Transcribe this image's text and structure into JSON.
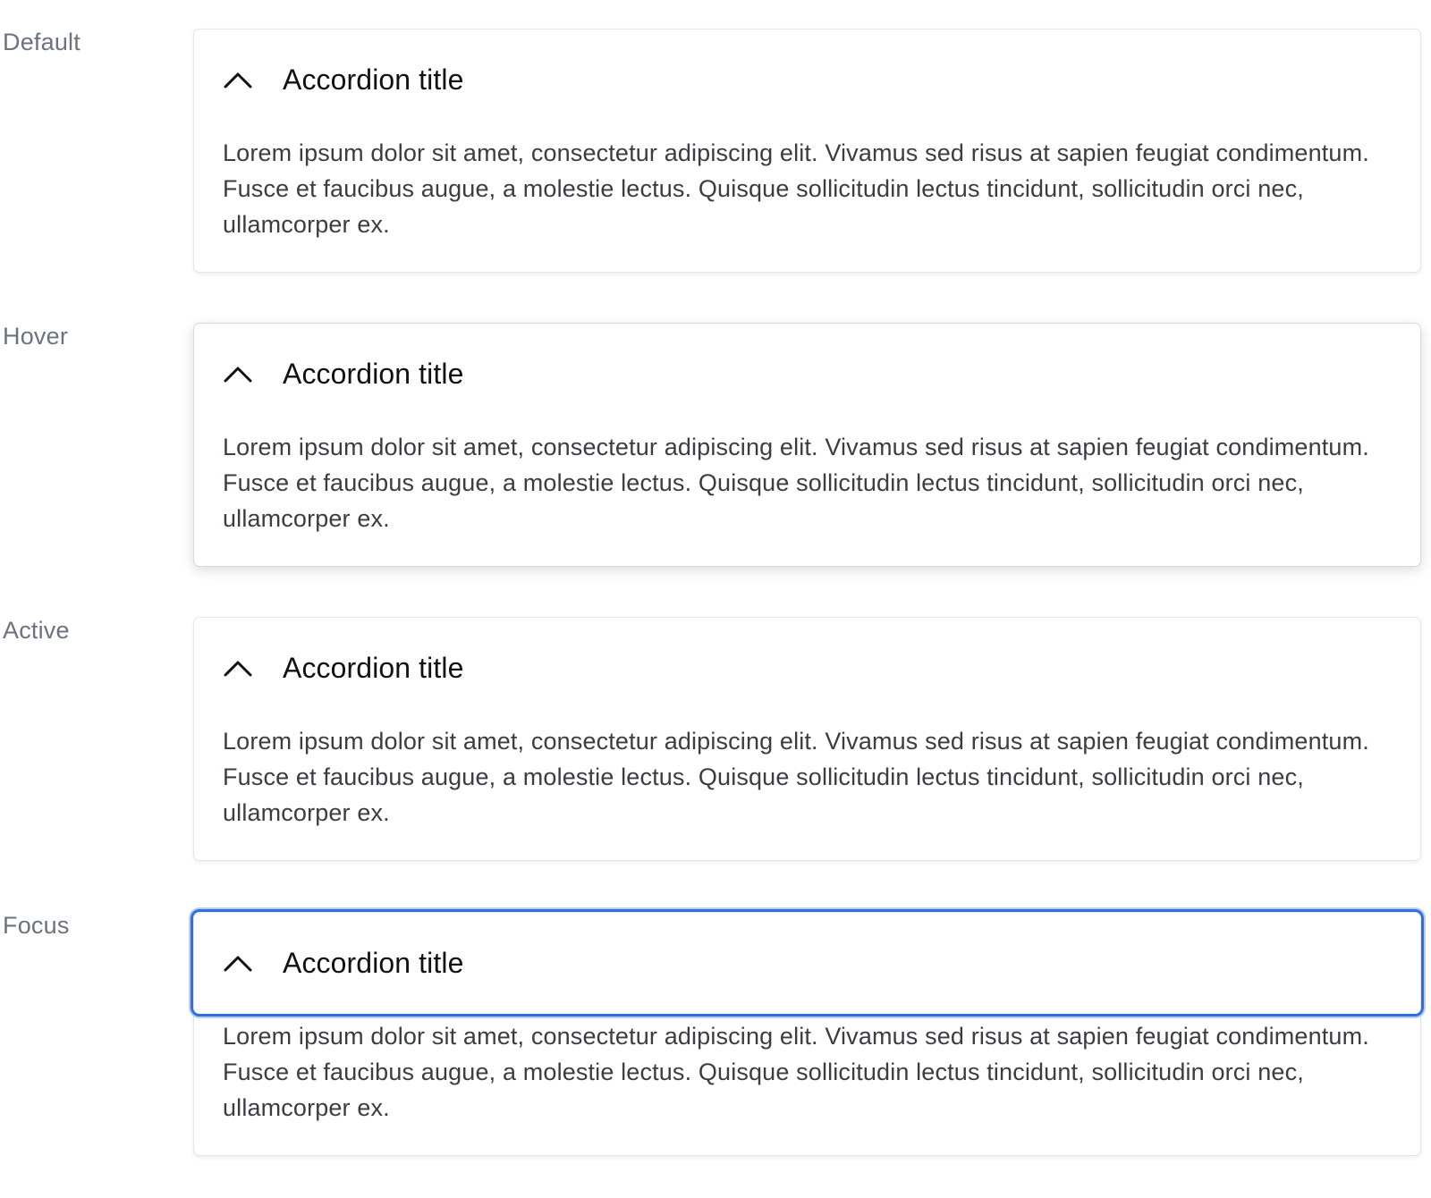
{
  "states": [
    {
      "label": "Default",
      "accordion": {
        "title": "Accordion title",
        "body": "Lorem ipsum dolor sit amet, consectetur adipiscing elit. Vivamus sed risus at sapien feugiat condimentum. Fusce et faucibus augue, a molestie lectus. Quisque sollicitudin lectus tincidunt, sollicitudin orci nec, ullamcorper ex.",
        "icon": "chevron-up-icon"
      }
    },
    {
      "label": "Hover",
      "accordion": {
        "title": "Accordion title",
        "body": "Lorem ipsum dolor sit amet, consectetur adipiscing elit. Vivamus sed risus at sapien feugiat condimentum. Fusce et faucibus augue, a molestie lectus. Quisque sollicitudin lectus tincidunt, sollicitudin orci nec, ullamcorper ex.",
        "icon": "chevron-up-icon"
      }
    },
    {
      "label": "Active",
      "accordion": {
        "title": "Accordion title",
        "body": "Lorem ipsum dolor sit amet, consectetur adipiscing elit. Vivamus sed risus at sapien feugiat condimentum. Fusce et faucibus augue, a molestie lectus. Quisque sollicitudin lectus tincidunt, sollicitudin orci nec, ullamcorper ex.",
        "icon": "chevron-up-icon"
      }
    },
    {
      "label": "Focus",
      "accordion": {
        "title": "Accordion title",
        "body": "Lorem ipsum dolor sit amet, consectetur adipiscing elit. Vivamus sed risus at sapien feugiat condimentum. Fusce et faucibus augue, a molestie lectus. Quisque sollicitudin lectus tincidunt, sollicitudin orci nec, ullamcorper ex.",
        "icon": "chevron-up-icon"
      }
    }
  ],
  "colors": {
    "label_text": "#6b7280",
    "title_text": "#111111",
    "body_text": "#3a3d42",
    "border": "#e3e5e8",
    "focus_ring": "#2f6fe0"
  }
}
